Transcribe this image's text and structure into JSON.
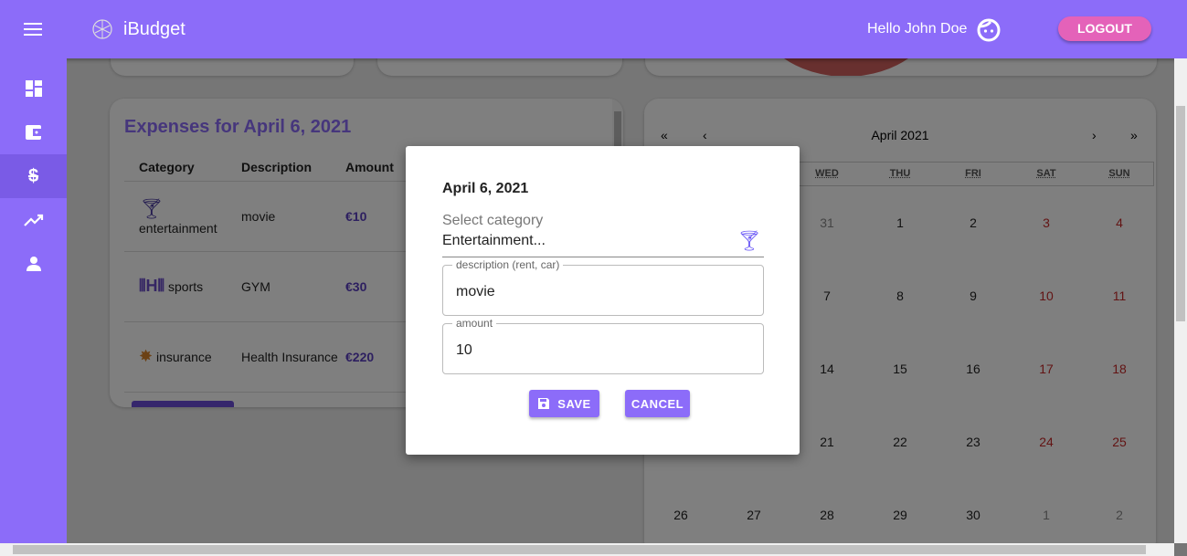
{
  "app": {
    "title": "iBudget",
    "greeting": "Hello John Doe",
    "logout": "LOGOUT"
  },
  "sidebar": {
    "items": [
      {
        "icon": "dashboard-icon"
      },
      {
        "icon": "wallet-icon"
      },
      {
        "icon": "money-off-icon",
        "active": true
      },
      {
        "icon": "trending-up-icon"
      },
      {
        "icon": "person-icon"
      }
    ]
  },
  "expenses": {
    "title": "Expenses for April 6, 2021",
    "headers": [
      "Category",
      "Description",
      "Amount"
    ],
    "rows": [
      {
        "icon": "cocktail-icon",
        "category": "entertainment",
        "description": "movie",
        "amount": "€10"
      },
      {
        "icon": "dumbbell-icon",
        "category": "sports",
        "description": "GYM",
        "amount": "€30"
      },
      {
        "icon": "car-crash-icon",
        "category": "insurance",
        "description": "Health Insurance",
        "amount": "€220"
      }
    ]
  },
  "calendar": {
    "month": "April 2021",
    "nav": [
      "«",
      "‹",
      "›",
      "»"
    ],
    "weekdays": [
      "",
      "",
      "WED",
      "THU",
      "FRI",
      "SAT",
      "SUN"
    ],
    "weeks": [
      [
        "",
        "",
        "31",
        "1",
        "2",
        "3",
        "4"
      ],
      [
        "",
        "",
        "7",
        "8",
        "9",
        "10",
        "11"
      ],
      [
        "",
        "",
        "14",
        "15",
        "16",
        "17",
        "18"
      ],
      [
        "",
        "",
        "21",
        "22",
        "23",
        "24",
        "25"
      ],
      [
        "26",
        "27",
        "28",
        "29",
        "30",
        "1",
        "2"
      ]
    ]
  },
  "modal": {
    "date": "April 6, 2021",
    "category_label": "Select category",
    "category_value": "Entertainment...",
    "description_label": "description (rent, car)",
    "description_value": "movie",
    "amount_label": "amount",
    "amount_value": "10",
    "save": "SAVE",
    "cancel": "CANCEL"
  },
  "colors": {
    "primary": "#8c6cf9",
    "logout": "#e462b9",
    "amount": "#5a3fc0",
    "weekend": "#c62828"
  }
}
